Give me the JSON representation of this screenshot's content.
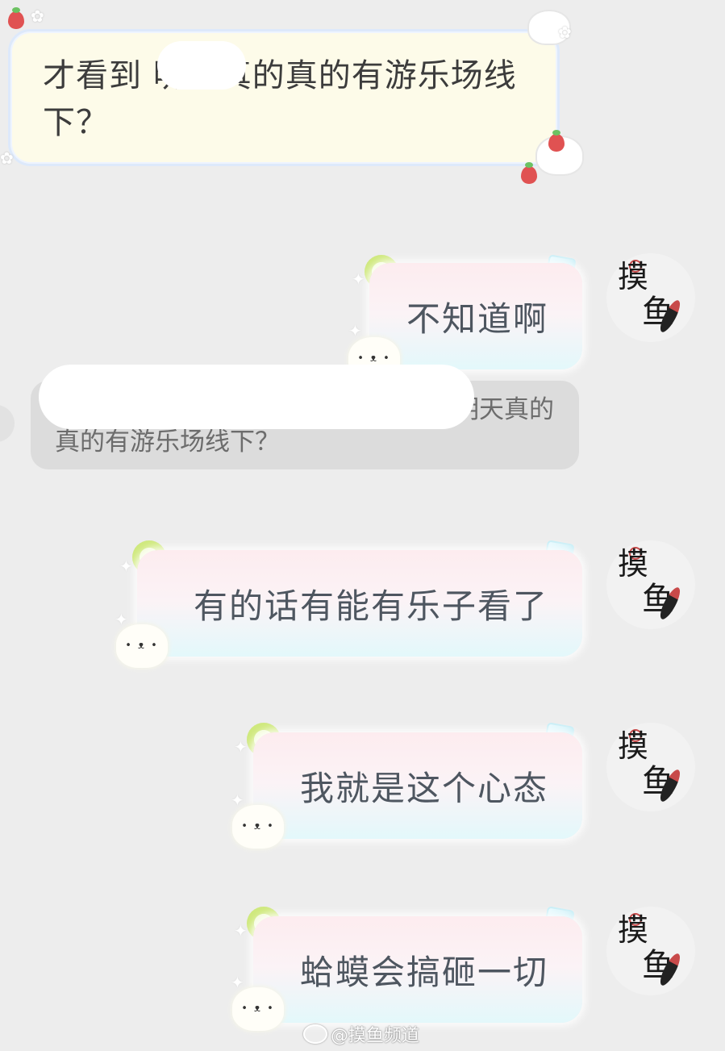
{
  "messages": [
    {
      "side": "in",
      "text": "才看到     明天真的真的有游乐场线下？"
    },
    {
      "side": "out",
      "text": "不知道啊"
    },
    {
      "side": "out",
      "text": "有的话有能有乐子看了"
    },
    {
      "side": "out",
      "text": "我就是这个心态"
    },
    {
      "side": "out",
      "text": "蛤蟆会搞砸一切"
    }
  ],
  "quote": {
    "text": "明天真的真的有游乐场线下？"
  },
  "avatar": {
    "char1": "摸",
    "char2": "鱼"
  },
  "watermark": {
    "text": "@摸鱼频道"
  }
}
